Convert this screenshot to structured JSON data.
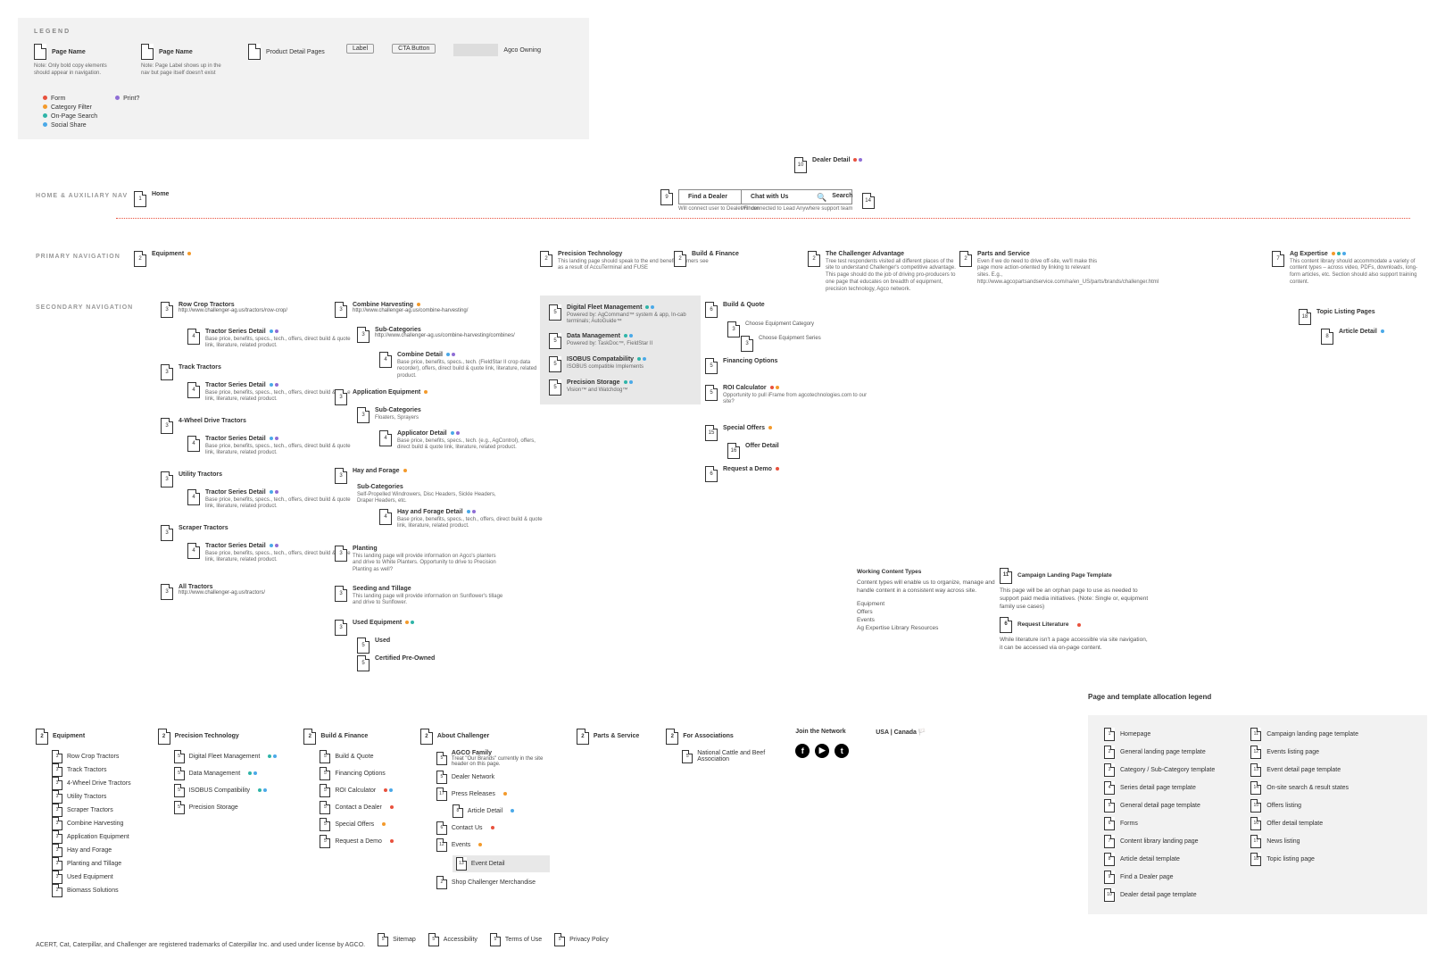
{
  "legend": {
    "title": "LEGEND",
    "page_name": "Page Name",
    "note1": "Note: Only bold copy elements should appear in navigation.",
    "note2": "Note: Page Label shows up in the nav but page itself doesn't exist",
    "product_detail": "Product Detail Pages",
    "label": "Label",
    "cta": "CTA Button",
    "agco": "Agco Owning",
    "tags": {
      "form": "Form",
      "category": "Category Filter",
      "search": "On-Page Search",
      "social": "Social Share",
      "print": "Print?"
    }
  },
  "sections": {
    "home_aux": "HOME & AUXILIARY NAV",
    "primary": "PRIMARY NAVIGATION",
    "secondary": "SECONDARY NAVIGATION"
  },
  "aux": {
    "home": "Home",
    "dealer_detail": "Dealer Detail",
    "find_dealer": "Find a Dealer",
    "find_dealer_sub": "Will connect user to Dealer Finder",
    "chat": "Chat with Us",
    "chat_sub": "Will connected to Lead Anywhere support team",
    "search": "Search"
  },
  "primary": {
    "equipment": {
      "num": "2",
      "title": "Equipment"
    },
    "precision": {
      "num": "2",
      "title": "Precision Technology",
      "sub": "This landing page should speak to the end benefits farmers see as a result of AccuTerminal and FUSE"
    },
    "build": {
      "num": "2",
      "title": "Build & Finance"
    },
    "advantage": {
      "num": "2",
      "title": "The Challenger Advantage",
      "sub": "Tree test respondents visited all different places of the site to understand Challenger's competitive advantage. This page should do the job of driving pro-producers to one page that educates on breadth of equipment, precision technology, Agco network."
    },
    "parts": {
      "num": "2",
      "title": "Parts and Service",
      "sub": "Even if we do need to drive off-site, we'll make this page more action-oriented by linking to relevant sites. E.g., http://www.agcopartsandservice.com/na/en_US/parts/brands/challenger.html"
    },
    "expertise": {
      "num": "7",
      "title": "Ag Expertise",
      "sub": "This content library should accommodate a variety of content types – across video, PDFs, downloads, long-form articles, etc. Section should also support training content."
    }
  },
  "equipment": {
    "row_crop": {
      "num": "3",
      "title": "Row Crop Tractors",
      "url": "http://www.challenger-ag.us/tractors/row-crop/"
    },
    "series_detail": {
      "num": "4",
      "title": "Tractor Series Detail",
      "desc": "Base price, benefits, specs., tech., offers, direct build & quote link, literature, related product."
    },
    "track": {
      "num": "3",
      "title": "Track Tractors"
    },
    "fourwd": {
      "num": "3",
      "title": "4-Wheel Drive Tractors"
    },
    "utility": {
      "num": "3",
      "title": "Utility Tractors"
    },
    "scraper": {
      "num": "3",
      "title": "Scraper Tractors"
    },
    "all": {
      "num": "3",
      "title": "All Tractors",
      "url": "http://www.challenger-ag.us/tractors/"
    },
    "combine": {
      "num": "3",
      "title": "Combine Harvesting",
      "url": "http://www.challenger-ag.us/combine-harvesting/"
    },
    "subcat": {
      "num": "3",
      "title": "Sub-Categories",
      "url": "http://www.challenger-ag.us/combine-harvesting/combines/"
    },
    "combine_detail": {
      "num": "4",
      "title": "Combine Detail",
      "desc": "Base price, benefits, specs., tech. (FieldStar II crop data recorder), offers, direct build & quote link, literature, related product."
    },
    "app_equip": {
      "num": "3",
      "title": "Application Equipment"
    },
    "subcat2": {
      "title": "Sub-Categories",
      "desc": "Floaters, Sprayers"
    },
    "applicator": {
      "num": "4",
      "title": "Applicator Detail",
      "desc": "Base price, benefits, specs., tech. (e.g., AgControl), offers, direct build & quote link, literature, related product."
    },
    "hay": {
      "num": "3",
      "title": "Hay and Forage"
    },
    "hay_sub": {
      "title": "Sub-Categories",
      "desc": "Self-Propelled Windrowers, Disc Headers, Sickle Headers, Draper Headers, etc."
    },
    "hay_detail": {
      "num": "4",
      "title": "Hay and Forage Detail",
      "desc": "Base price, benefits, specs., tech., offers, direct build & quote link, literature, related product."
    },
    "planting": {
      "num": "3",
      "title": "Planting",
      "desc": "This landing page will provide information on Agco's planters and drive to White Planters. Opportunity to drive to Precision Planting as well?"
    },
    "seeding": {
      "num": "3",
      "title": "Seeding and Tillage",
      "desc": "This landing page will provide information on Sunflower's tillage and drive to Sunflower."
    },
    "used": {
      "num": "3",
      "title": "Used Equipment"
    },
    "used_u": {
      "num": "5",
      "title": "Used"
    },
    "used_cpo": {
      "num": "5",
      "title": "Certified Pre-Owned"
    }
  },
  "precision_items": {
    "dfm": {
      "num": "5",
      "title": "Digital Fleet Management",
      "desc": "Powered by: AgCommand™ system & app, In-cab terminals; AutoGuide™"
    },
    "data": {
      "num": "5",
      "title": "Data Management",
      "desc": "Powered by: TaskDoc™, FieldStar II"
    },
    "isobus": {
      "num": "5",
      "title": "ISOBUS Compatability",
      "desc": "ISOBUS compatible Implements"
    },
    "storage": {
      "num": "5",
      "title": "Precision Storage",
      "desc": "Vision™ and Watchdog™"
    }
  },
  "build_items": {
    "bq": {
      "num": "6",
      "title": "Build & Quote"
    },
    "choose_cat": {
      "num": "3",
      "title": "Choose Equipment Category"
    },
    "choose_series": {
      "num": "3",
      "title": "Choose Equipment Series"
    },
    "fin": {
      "num": "5",
      "title": "Financing Options"
    },
    "roi": {
      "num": "5",
      "title": "ROI Calculator",
      "desc": "Opportunity to pull iFrame from agcotechnologies.com to our site?"
    },
    "offers": {
      "num": "15",
      "title": "Special Offers"
    },
    "offer_detail": {
      "num": "16",
      "title": "Offer Detail"
    },
    "demo": {
      "num": "6",
      "title": "Request a Demo"
    }
  },
  "expertise_items": {
    "topic": {
      "num": "18",
      "title": "Topic Listing Pages"
    },
    "article": {
      "num": "8",
      "title": "Article Detail"
    }
  },
  "side": {
    "wct_title": "Working Content Types",
    "wct_desc": "Content types will enable us to organize, manage and handle content in a consistent way across site.",
    "wct_list": [
      "Equipment",
      "Offers",
      "Events",
      "Ag Expertise Library Resources"
    ],
    "campaign": {
      "num": "11",
      "title": "Campaign Landing Page Template",
      "desc": "This page will be an orphan page to use as needed to support paid media initiatives. (Note: Single or, equipment family use cases)"
    },
    "request_lit": {
      "num": "6",
      "title": "Request Literature",
      "desc": "While literature isn't a page accessible via site navigation, it can be accessed via on-page content."
    }
  },
  "footer": {
    "col1_head": "Equipment",
    "col1": [
      "Row Crop Tractors",
      "Track Tractors",
      "4-Wheel Drive Tractors",
      "Utility Tractors",
      "Scraper Tractors",
      "Combine Harvesting",
      "Application Equipment",
      "Hay and Forage",
      "Planting and Tillage",
      "Used Equipment",
      "Biomass Solutions"
    ],
    "col1_nums": [
      "3",
      "3",
      "3",
      "3",
      "3",
      "3",
      "3",
      "3",
      "3",
      "3",
      "2"
    ],
    "col2_head": "Precision Technology",
    "col2": [
      "Digital Fleet Management",
      "Data Management",
      "ISOBUS Compatibility",
      "Precision Storage"
    ],
    "col3_head": "Build & Finance",
    "col3": [
      "Build & Quote",
      "Financing Options",
      "ROI Calculator",
      "Contact a Dealer",
      "Special Offers",
      "Request a Demo"
    ],
    "col3_nums": [
      "5",
      "5",
      "5",
      "5",
      "5",
      "5"
    ],
    "col4_head": "About Challenger",
    "col4_agco": "AGCO Family",
    "col4_agco_sub": "Treat \"Our Brands\" currently in the site header on this page.",
    "col4_dealer": "Dealer Network",
    "col4_press": "Press Releases",
    "col4_article": "Article Detail",
    "col4_contact": "Contact Us",
    "col4_events": "Events",
    "col4_event_detail": "Event Detail",
    "col4_shop": "Shop Challenger Merchandise",
    "col5_head": "Parts & Service",
    "col6_head": "For Associations",
    "col6_item": "National Cattle and Beef Association",
    "join": "Join the Network",
    "locale": "USA | Canada",
    "trademark": "ACERT, Cat, Caterpillar, and Challenger are registered trademarks of Caterpillar Inc. and used under license by AGCO.",
    "sitemap": "Sitemap",
    "access": "Accessibility",
    "tou": "Terms of Use",
    "privacy": "Privacy Policy"
  },
  "alloc": {
    "title": "Page and template allocation legend",
    "left": [
      {
        "n": "1",
        "t": "Homepage"
      },
      {
        "n": "2",
        "t": "General landing page template"
      },
      {
        "n": "3",
        "t": "Category / Sub-Category template"
      },
      {
        "n": "4",
        "t": "Series detail page template"
      },
      {
        "n": "5",
        "t": "General detail page template"
      },
      {
        "n": "6",
        "t": "Forms"
      },
      {
        "n": "7",
        "t": "Content library landing page"
      },
      {
        "n": "8",
        "t": "Article detail template"
      },
      {
        "n": "9",
        "t": "Find a Dealer page"
      },
      {
        "n": "10",
        "t": "Dealer detail page template"
      }
    ],
    "right": [
      {
        "n": "11",
        "t": "Campaign landing page template"
      },
      {
        "n": "12",
        "t": "Events listing page"
      },
      {
        "n": "13",
        "t": "Event detail page template"
      },
      {
        "n": "14",
        "t": "On-site search & result states"
      },
      {
        "n": "15",
        "t": "Offers listing"
      },
      {
        "n": "16",
        "t": "Offer detail template"
      },
      {
        "n": "17",
        "t": "News listing"
      },
      {
        "n": "18",
        "t": "Topic listing page"
      }
    ]
  }
}
